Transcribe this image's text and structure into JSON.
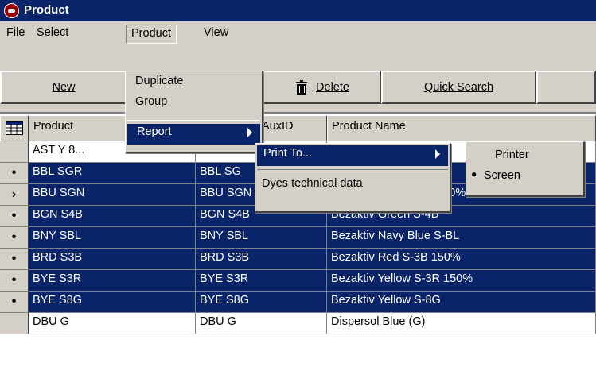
{
  "window": {
    "title": "Product"
  },
  "menubar": {
    "items": [
      "File",
      "Select",
      "Product",
      "View"
    ]
  },
  "toolbar": {
    "new_label": "New",
    "delete_label": "Delete",
    "quick_search_label": "Quick Search"
  },
  "grid": {
    "columns": [
      "Product",
      "AuxID",
      "Product Name"
    ],
    "rows": [
      {
        "marker": "",
        "product": "AST Y 8...",
        "aux": "",
        "name": ""
      },
      {
        "marker": "•",
        "product": "BBL SGR",
        "aux": "BBL SG",
        "name": ""
      },
      {
        "marker": "›",
        "product": "BBU SGN",
        "aux": "BBU SGN",
        "name": "Bezaktiv Blue S-GN 150%"
      },
      {
        "marker": "•",
        "product": "BGN S4B",
        "aux": "BGN S4B",
        "name": "Bezaktiv Green S-4B"
      },
      {
        "marker": "•",
        "product": "BNY SBL",
        "aux": "BNY SBL",
        "name": "Bezaktiv Navy Blue S-BL"
      },
      {
        "marker": "•",
        "product": "BRD S3B",
        "aux": "BRD S3B",
        "name": "Bezaktiv Red S-3B 150%"
      },
      {
        "marker": "•",
        "product": "BYE S3R",
        "aux": "BYE S3R",
        "name": "Bezaktiv Yellow S-3R 150%"
      },
      {
        "marker": "•",
        "product": "BYE S8G",
        "aux": "BYE S8G",
        "name": "Bezaktiv Yellow S-8G"
      },
      {
        "marker": "",
        "product": "DBU G",
        "aux": "DBU G",
        "name": "Dispersol Blue (G)"
      }
    ]
  },
  "product_menu": {
    "items": [
      "Duplicate",
      "Group",
      "Report"
    ]
  },
  "report_menu": {
    "items": [
      "Print To...",
      "Dyes technical data"
    ]
  },
  "print_to_menu": {
    "items": [
      "Printer",
      "Screen"
    ],
    "selected_bullet": "●"
  }
}
